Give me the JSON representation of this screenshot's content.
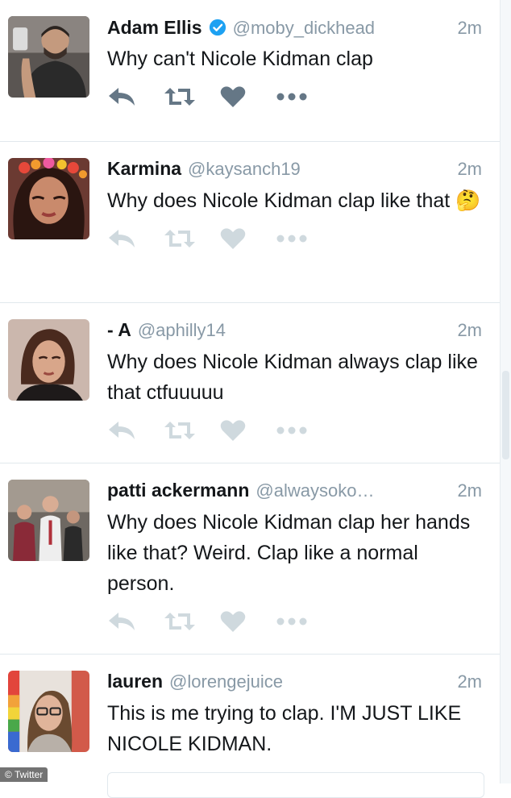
{
  "tweets": [
    {
      "name": "Adam Ellis",
      "verified": true,
      "handle": "@moby_dickhead",
      "time": "2m",
      "text": "Why can't Nicole Kidman clap",
      "actions_style": "dark"
    },
    {
      "name": "Karmina",
      "verified": false,
      "handle": "@kaysanch19",
      "time": "2m",
      "text": "Why does Nicole Kidman clap like that 🤔",
      "actions_style": "muted"
    },
    {
      "name": "- A",
      "verified": false,
      "handle": "@aphilly14",
      "time": "2m",
      "text": "Why does Nicole Kidman always clap like that ctfuuuuu",
      "actions_style": "muted"
    },
    {
      "name": "patti ackermann",
      "verified": false,
      "handle": "@alwaysoko…",
      "time": "2m",
      "text": "Why does Nicole Kidman clap her hands like that? Weird. Clap like a normal person.",
      "actions_style": "muted"
    },
    {
      "name": "lauren",
      "verified": false,
      "handle": "@lorengejuice",
      "time": "2m",
      "text": "This is me trying to clap. I'M JUST LIKE NICOLE KIDMAN.",
      "actions_style": "none"
    }
  ],
  "icons": [
    "reply-icon",
    "retweet-icon",
    "like-icon",
    "more-icon",
    "verified-badge-icon"
  ],
  "colors": {
    "text": "#14171a",
    "secondary": "#8899a6",
    "verified": "#1da1f2",
    "divider": "#e1e8ed"
  },
  "watermark": "© Twitter"
}
